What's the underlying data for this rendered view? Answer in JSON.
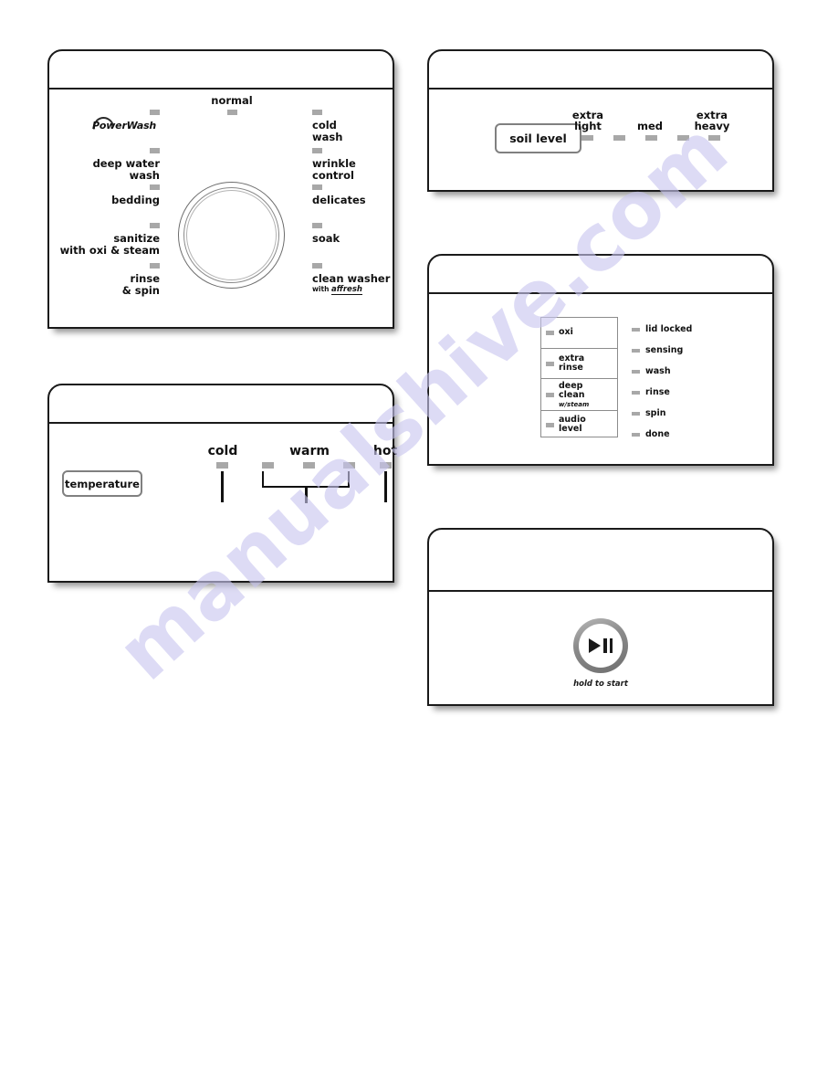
{
  "watermark": {
    "text": "manualshive.com"
  },
  "cycle_panel": {
    "name": "cycle selector",
    "dial": "cycle-selector-dial",
    "top_cycle": "normal",
    "left_cycles": [
      {
        "label": "PowerWash",
        "logo": true
      },
      {
        "label": "deep water\nwash",
        "line1": "deep water",
        "line2": "wash"
      },
      {
        "label": "bedding",
        "line1": "bedding",
        "line2": ""
      },
      {
        "label": "sanitize\nwith oxi & steam",
        "line1": "sanitize",
        "line2": "with oxi & steam"
      },
      {
        "label": "rinse\n& spin",
        "line1": "rinse",
        "line2": "& spin"
      }
    ],
    "right_cycles": [
      {
        "line1": "cold",
        "line2": "wash"
      },
      {
        "line1": "wrinkle",
        "line2": "control"
      },
      {
        "line1": "delicates",
        "line2": ""
      },
      {
        "line1": "soak",
        "line2": ""
      },
      {
        "line1": "clean washer",
        "line2": "with ",
        "brand": "affresh"
      }
    ]
  },
  "temperature_panel": {
    "button_label": "temperature",
    "settings": [
      {
        "label": "cold"
      },
      {
        "label": "warm"
      },
      {
        "label": "hot"
      }
    ]
  },
  "soil_panel": {
    "button_label": "soil level",
    "levels": [
      {
        "line1": "extra",
        "line2": "light"
      },
      {
        "line1": "",
        "line2": "med"
      },
      {
        "line1": "extra",
        "line2": "heavy"
      }
    ],
    "led_count": 5
  },
  "options_panel": {
    "options": [
      {
        "line1": "oxi",
        "line2": "",
        "sub": ""
      },
      {
        "line1": "extra",
        "line2": "rinse",
        "sub": ""
      },
      {
        "line1": "deep",
        "line2": "clean",
        "sub": "w/steam"
      },
      {
        "line1": "audio",
        "line2": "level",
        "sub": ""
      }
    ],
    "status": [
      {
        "label": "lid locked"
      },
      {
        "label": "sensing"
      },
      {
        "label": "wash"
      },
      {
        "label": "rinse"
      },
      {
        "label": "spin"
      },
      {
        "label": "done"
      }
    ]
  },
  "start_panel": {
    "caption": "hold to start",
    "glyph": "play-pause-icon"
  },
  "colors": {
    "led": "#a8a8a8",
    "outline": "#1a1a1a",
    "button_outline": "#808080",
    "watermark": "#c9c6ef"
  }
}
